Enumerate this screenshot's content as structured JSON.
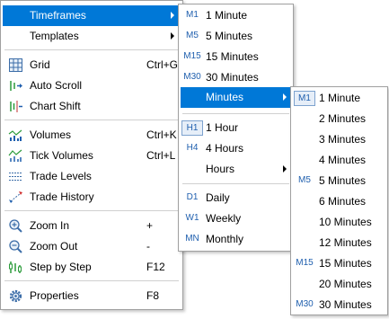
{
  "main_menu": {
    "timeframes": "Timeframes",
    "templates": "Templates",
    "grid": "Grid",
    "grid_shortcut": "Ctrl+G",
    "auto_scroll": "Auto Scroll",
    "chart_shift": "Chart Shift",
    "volumes": "Volumes",
    "volumes_shortcut": "Ctrl+K",
    "tick_volumes": "Tick Volumes",
    "tick_volumes_shortcut": "Ctrl+L",
    "trade_levels": "Trade Levels",
    "trade_history": "Trade History",
    "zoom_in": "Zoom In",
    "zoom_in_shortcut": "+",
    "zoom_out": "Zoom Out",
    "zoom_out_shortcut": "-",
    "step_by_step": "Step by Step",
    "step_by_step_shortcut": "F12",
    "properties": "Properties",
    "properties_shortcut": "F8"
  },
  "timeframes_menu": {
    "items": [
      {
        "code": "M1",
        "label": "1 Minute"
      },
      {
        "code": "M5",
        "label": "5 Minutes"
      },
      {
        "code": "M15",
        "label": "15 Minutes"
      },
      {
        "code": "M30",
        "label": "30 Minutes"
      },
      {
        "code": "",
        "label": "Minutes"
      },
      {
        "code": "H1",
        "label": "1 Hour"
      },
      {
        "code": "H4",
        "label": "4 Hours"
      },
      {
        "code": "",
        "label": "Hours"
      },
      {
        "code": "D1",
        "label": "Daily"
      },
      {
        "code": "W1",
        "label": "Weekly"
      },
      {
        "code": "MN",
        "label": "Monthly"
      }
    ]
  },
  "minutes_menu": {
    "items": [
      {
        "code": "M1",
        "label": "1 Minute"
      },
      {
        "code": "",
        "label": "2 Minutes"
      },
      {
        "code": "",
        "label": "3 Minutes"
      },
      {
        "code": "",
        "label": "4 Minutes"
      },
      {
        "code": "M5",
        "label": "5 Minutes"
      },
      {
        "code": "",
        "label": "6 Minutes"
      },
      {
        "code": "",
        "label": "10 Minutes"
      },
      {
        "code": "",
        "label": "12 Minutes"
      },
      {
        "code": "M15",
        "label": "15 Minutes"
      },
      {
        "code": "",
        "label": "20 Minutes"
      },
      {
        "code": "M30",
        "label": "30 Minutes"
      }
    ]
  },
  "colors": {
    "highlight": "#0078d7",
    "timeframe_code": "#1f5fae",
    "separator": "#d0d0d0",
    "border": "#a0a0a0"
  },
  "icons": {
    "grid": "grid-icon",
    "auto_scroll": "auto-scroll-icon",
    "chart_shift": "chart-shift-icon",
    "volumes": "volumes-icon",
    "tick_volumes": "tick-volumes-icon",
    "trade_levels": "trade-levels-icon",
    "trade_history": "trade-history-icon",
    "zoom_in": "zoom-in-icon",
    "zoom_out": "zoom-out-icon",
    "step_by_step": "step-by-step-icon",
    "properties": "gear-icon"
  }
}
